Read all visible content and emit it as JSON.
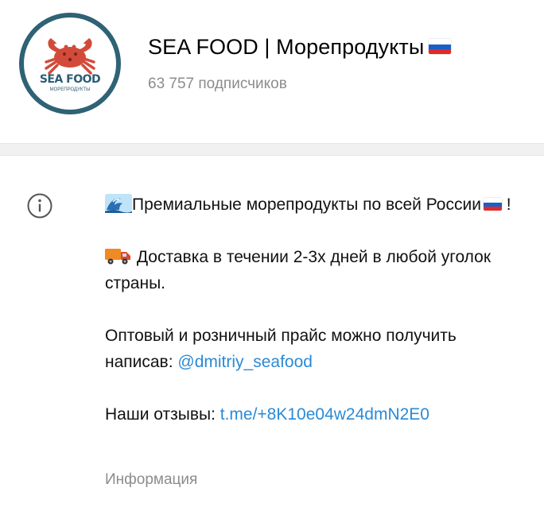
{
  "channel": {
    "title": "SEA FOOD | Морепродукты",
    "subscribers": "63 757 подписчиков",
    "avatar": {
      "logo_text": "SEA FOOD",
      "logo_sub": "МОРЕПРОДУКТЫ"
    }
  },
  "info": {
    "line1": "Премиальные морепродукты по всей России",
    "line1_end": " !",
    "line2": " Доставка в течении 2-3х дней в любой уголок страны.",
    "line3": "Оптовый и розничный прайс можно получить написав: ",
    "line3_link": "@dmitriy_seafood",
    "line4": "Наши отзывы: ",
    "line4_link": "t.me/+8K10e04w24dmN2E0",
    "label": "Информация"
  },
  "colors": {
    "link": "#2a8ad6",
    "muted": "#8c8c8c",
    "avatar_ring": "#2f6275",
    "crab": "#d24b3a"
  },
  "icons": [
    "info-icon",
    "wave-emoji",
    "truck-emoji",
    "russia-flag"
  ]
}
